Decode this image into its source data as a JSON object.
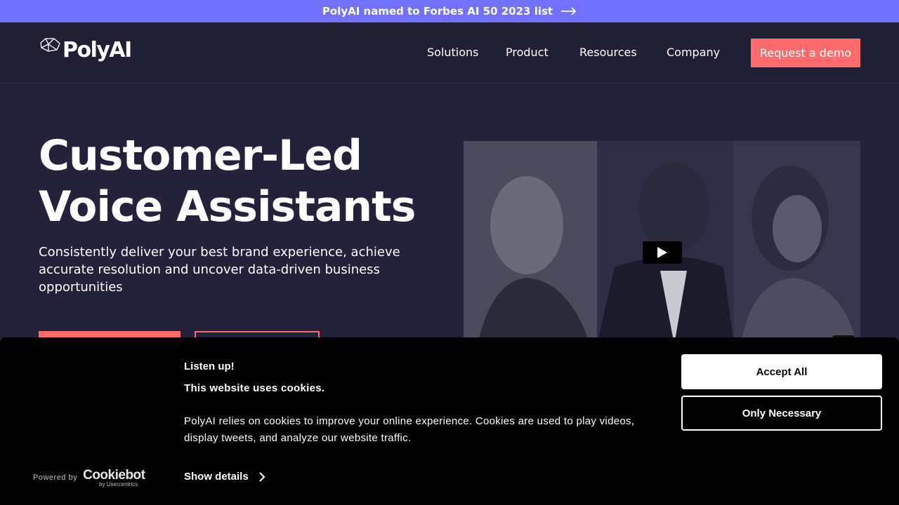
{
  "announcement": {
    "text": "PolyAI named to Forbes AI 50 2023 list",
    "icon": "arrow-right-icon"
  },
  "header": {
    "logo_text": "PolyAI",
    "nav": [
      "Solutions",
      "Product",
      "Resources",
      "Company"
    ],
    "cta_label": "Request a demo"
  },
  "hero": {
    "title_line1": "Customer-Led",
    "title_line2": "Voice Assistants",
    "subtitle": "Consistently deliver your best brand experience, achieve accurate resolution and uncover data-driven business opportunities"
  },
  "video": {
    "play_icon": "play-icon"
  },
  "cookie_banner": {
    "title": "Listen up!",
    "subtitle": "This website uses cookies.",
    "body": "PolyAI relies on cookies to improve your online experience. Cookies are used to play videos, display tweets, and analyze our website traffic.",
    "show_details_label": "Show details",
    "accept_label": "Accept All",
    "necessary_label": "Only Necessary",
    "powered_by_label": "Powered by",
    "powered_by_brand": "Cookiebot",
    "powered_by_sub": "by Usercentrics"
  },
  "colors": {
    "announcement_bg": "#7270ff",
    "page_bg": "#23223a",
    "accent": "#ff6b6b",
    "cookie_bg": "#000000"
  }
}
